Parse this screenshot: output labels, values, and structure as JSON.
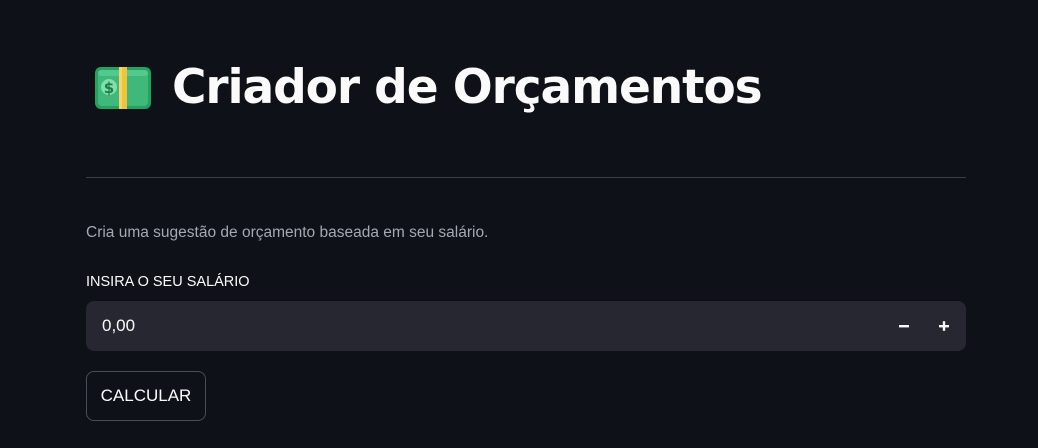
{
  "header": {
    "icon": "money-bill-icon",
    "title": "Criador de Orçamentos"
  },
  "description": "Cria uma sugestão de orçamento baseada em seu salário.",
  "salary_field": {
    "label": "INSIRA O SEU SALÁRIO",
    "value": "0,00",
    "decrement_icon": "minus-icon",
    "increment_icon": "plus-icon"
  },
  "calculate_button": {
    "label": "CALCULAR"
  },
  "colors": {
    "background": "#0e1117",
    "input_background": "#262730",
    "text": "#fafafa",
    "muted_text": "#a4a8b1",
    "money_green": "#3fb87a",
    "money_band": "#f3c23c"
  }
}
